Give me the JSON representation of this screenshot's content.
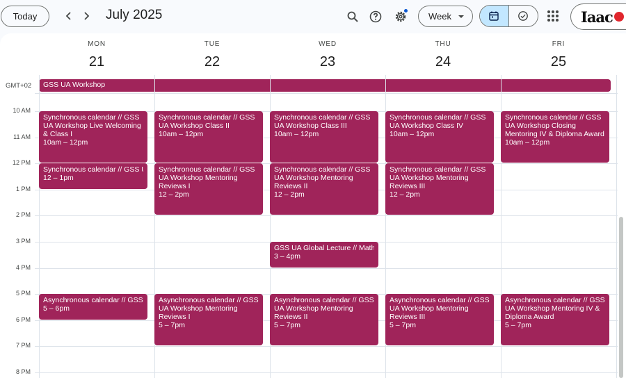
{
  "toolbar": {
    "today_label": "Today",
    "month_title": "July 2025",
    "view_label": "Week",
    "brand_text": "Iaac"
  },
  "colors": {
    "event": "#a0245a",
    "selected_toggle": "#c2e7ff",
    "settings_dot": "#0b57d0"
  },
  "icons": [
    "chevron-left-icon",
    "chevron-right-icon",
    "search-icon",
    "help-icon",
    "gear-icon",
    "calendar-icon",
    "task-check-icon",
    "apps-grid-icon"
  ],
  "calendar": {
    "timezone": "GMT+02",
    "days": [
      {
        "dow": "MON",
        "date": "21"
      },
      {
        "dow": "TUE",
        "date": "22"
      },
      {
        "dow": "WED",
        "date": "23"
      },
      {
        "dow": "THU",
        "date": "24"
      },
      {
        "dow": "FRI",
        "date": "25"
      }
    ],
    "hours": [
      "10 AM",
      "11 AM",
      "12 PM",
      "1 PM",
      "2 PM",
      "3 PM",
      "4 PM",
      "5 PM",
      "6 PM",
      "7 PM",
      "8 PM"
    ],
    "all_day_event": "GSS UA Workshop",
    "events": [
      {
        "day": 0,
        "start": 10,
        "end": 12,
        "title": "Synchronous calendar // GSS UA Workshop Live Welcoming & Class I",
        "time": "10am – 12pm"
      },
      {
        "day": 0,
        "start": 12,
        "end": 13,
        "title": "Synchronous calendar // GSS UA Workshop",
        "time": "12 – 1pm"
      },
      {
        "day": 0,
        "start": 17,
        "end": 18,
        "title": "Asynchronous calendar // GSS UA Workshop",
        "time": "5 – 6pm"
      },
      {
        "day": 1,
        "start": 10,
        "end": 12,
        "title": "Synchronous calendar // GSS UA Workshop Class II",
        "time": "10am – 12pm"
      },
      {
        "day": 1,
        "start": 12,
        "end": 14,
        "title": "Synchronous calendar // GSS UA Workshop Mentoring Reviews I",
        "time": "12 – 2pm"
      },
      {
        "day": 1,
        "start": 17,
        "end": 19,
        "title": "Asynchronous calendar // GSS UA Workshop Mentoring Reviews I",
        "time": "5 – 7pm"
      },
      {
        "day": 2,
        "start": 10,
        "end": 12,
        "title": "Synchronous calendar // GSS UA Workshop Class III",
        "time": "10am – 12pm"
      },
      {
        "day": 2,
        "start": 12,
        "end": 14,
        "title": "Synchronous calendar // GSS UA Workshop Mentoring Reviews II",
        "time": "12 – 2pm"
      },
      {
        "day": 2,
        "start": 15,
        "end": 16,
        "title": "GSS UA Global Lecture // Mathilde",
        "time": "3 – 4pm"
      },
      {
        "day": 2,
        "start": 17,
        "end": 19,
        "title": "Asynchronous calendar // GSS UA Workshop Mentoring Reviews II",
        "time": "5 – 7pm"
      },
      {
        "day": 3,
        "start": 10,
        "end": 12,
        "title": "Synchronous calendar // GSS UA Workshop Class IV",
        "time": "10am – 12pm"
      },
      {
        "day": 3,
        "start": 12,
        "end": 14,
        "title": "Synchronous calendar // GSS UA Workshop Mentoring Reviews III",
        "time": "12 – 2pm"
      },
      {
        "day": 3,
        "start": 17,
        "end": 19,
        "title": "Asynchronous calendar // GSS UA Workshop Mentoring Reviews III",
        "time": "5 – 7pm"
      },
      {
        "day": 4,
        "start": 10,
        "end": 12,
        "title": "Synchronous calendar // GSS UA Workshop Closing Mentoring IV & Diploma Award",
        "time": "10am – 12pm"
      },
      {
        "day": 4,
        "start": 17,
        "end": 19,
        "title": "Asynchronous calendar // GSS UA Workshop Mentoring IV & Diploma Award",
        "time": "5 – 7pm"
      }
    ]
  }
}
